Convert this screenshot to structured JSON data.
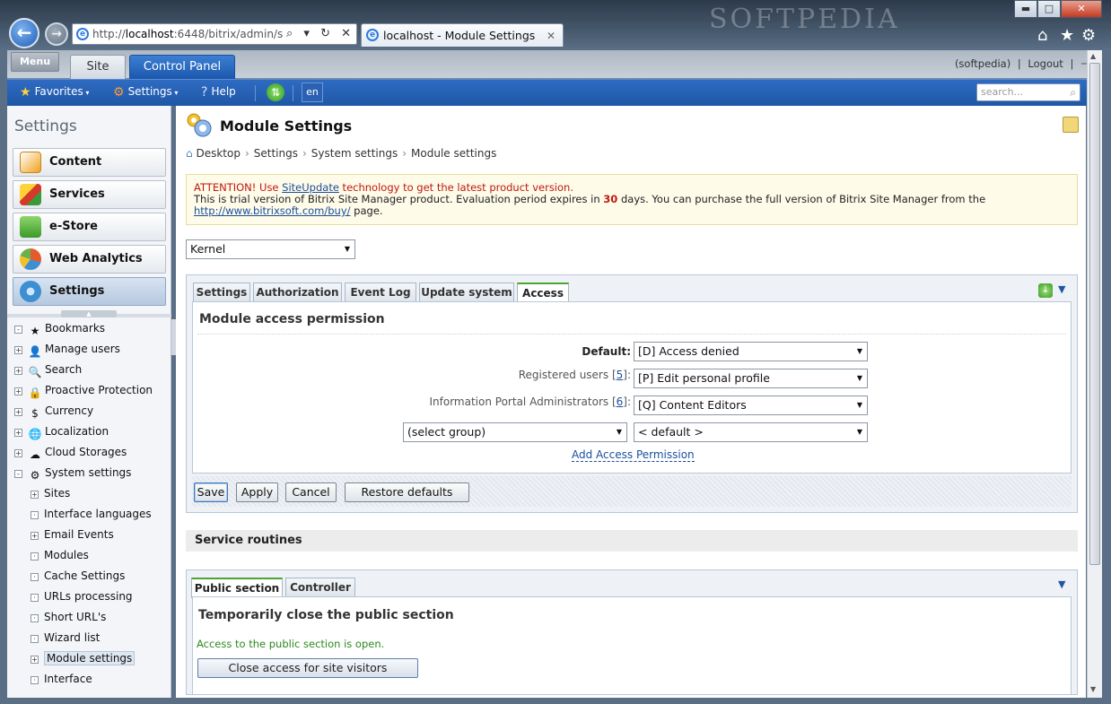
{
  "browser": {
    "address": "http://localhost:6448/bitrix/admin/setti",
    "address_domain": "localhost",
    "address_prefix": "http://",
    "address_rest": ":6448/bitrix/admin/setti",
    "address_controls": "⌕ ▾ ↻ ✕",
    "tab_title": "localhost - Module Settings",
    "tab_close": "✕",
    "watermark": "SOFTPEDIA",
    "win_min": "▬",
    "win_max": "□",
    "win_close": "✕",
    "home": "⌂",
    "star": "★",
    "gear": "⚙"
  },
  "panel": {
    "menu": "Menu",
    "tab_site": "Site",
    "tab_control_panel": "Control Panel",
    "user": "(softpedia)",
    "separator": "|",
    "logout": "Logout",
    "pin": "⊣"
  },
  "toolbar": {
    "favorites": "Favorites",
    "settings": "Settings",
    "help": "Help",
    "lang": "en",
    "search_placeholder": "search..."
  },
  "sidebar": {
    "title": "Settings",
    "sections": [
      {
        "label": "Content",
        "color": "#f0a21b"
      },
      {
        "label": "Services",
        "color": "#3a9a3a"
      },
      {
        "label": "e-Store",
        "color": "#5bb13a"
      },
      {
        "label": "Web Analytics",
        "color": "#e35b2d"
      },
      {
        "label": "Settings",
        "color": "#3d8fd1"
      }
    ],
    "tree": [
      {
        "label": "Bookmarks",
        "pm": "-",
        "icon": "★",
        "level": 0
      },
      {
        "label": "Manage users",
        "pm": "+",
        "icon": "👤",
        "level": 0
      },
      {
        "label": "Search",
        "pm": "+",
        "icon": "🔍",
        "level": 0
      },
      {
        "label": "Proactive Protection",
        "pm": "+",
        "icon": "🔒",
        "level": 0
      },
      {
        "label": "Currency",
        "pm": "+",
        "icon": "$",
        "level": 0
      },
      {
        "label": "Localization",
        "pm": "+",
        "icon": "🌐",
        "level": 0
      },
      {
        "label": "Cloud Storages",
        "pm": "+",
        "icon": "☁",
        "level": 0
      },
      {
        "label": "System settings",
        "pm": "-",
        "icon": "⚙",
        "level": 0
      },
      {
        "label": "Sites",
        "pm": "+",
        "icon": "",
        "level": 1
      },
      {
        "label": "Interface languages",
        "pm": "·",
        "icon": "",
        "level": 1
      },
      {
        "label": "Email Events",
        "pm": "+",
        "icon": "",
        "level": 1
      },
      {
        "label": "Modules",
        "pm": "·",
        "icon": "",
        "level": 1
      },
      {
        "label": "Cache Settings",
        "pm": "·",
        "icon": "",
        "level": 1
      },
      {
        "label": "URLs processing",
        "pm": "·",
        "icon": "",
        "level": 1
      },
      {
        "label": "Short URL's",
        "pm": "·",
        "icon": "",
        "level": 1
      },
      {
        "label": "Wizard list",
        "pm": "·",
        "icon": "",
        "level": 1
      },
      {
        "label": "Module settings",
        "pm": "+",
        "icon": "",
        "level": 1,
        "selected": true
      },
      {
        "label": "Interface",
        "pm": "·",
        "icon": "",
        "level": 1
      }
    ]
  },
  "main": {
    "title": "Module Settings",
    "breadcrumb": [
      "Desktop",
      "Settings",
      "System settings",
      "Module settings"
    ],
    "breadcrumb_sep": "›",
    "notice": {
      "line1_prefix": "ATTENTION! Use ",
      "line1_link": "SiteUpdate",
      "line1_suffix": " technology to get the latest product version.",
      "line2_prefix": "This is trial version of Bitrix Site Manager product. Evaluation period expires in ",
      "days": "30",
      "line2_suffix": " days. You can purchase the full version of Bitrix Site Manager from the",
      "url": "http://www.bitrixsoft.com/buy/",
      "line3_suffix": " page."
    },
    "module_select": "Kernel",
    "tabs": [
      "Settings",
      "Authorization",
      "Event Log",
      "Update system",
      "Access"
    ],
    "active_tab": "Access",
    "section_title": "Module access permission",
    "permissions": [
      {
        "label": "Default:",
        "bold": true,
        "value": "[D] Access denied"
      },
      {
        "label": "Registered users",
        "link": "5",
        "value": "[P] Edit personal profile"
      },
      {
        "label": "Information Portal Administrators",
        "link": "6",
        "value": "[Q] Content Editors"
      }
    ],
    "group_select": "(select group)",
    "default_select": "< default >",
    "add_permission": "Add Access Permission",
    "buttons": {
      "save": "Save",
      "apply": "Apply",
      "cancel": "Cancel",
      "restore": "Restore defaults"
    },
    "service_header": "Service routines",
    "service_tabs": [
      "Public section",
      "Controller"
    ],
    "close_title": "Temporarily close the public section",
    "open_status": "Access to the public section is open.",
    "close_button": "Close access for site visitors"
  }
}
